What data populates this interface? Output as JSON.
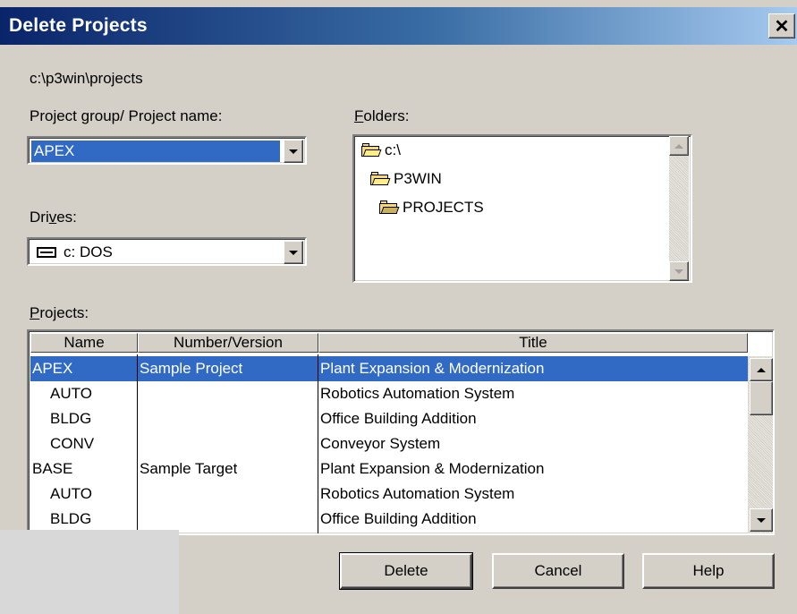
{
  "window": {
    "title": "Delete Projects"
  },
  "path": "c:\\p3win\\projects",
  "project_group": {
    "label": "Project group/ Project name:",
    "value": "APEX"
  },
  "drives": {
    "label_pre": "Dri",
    "label_u": "v",
    "label_post": "es:",
    "value": "c: DOS"
  },
  "folders": {
    "label_u": "F",
    "label_post": "olders:",
    "items": [
      "c:\\",
      "P3WIN",
      "PROJECTS"
    ]
  },
  "projects": {
    "label_u": "P",
    "label_post": "rojects:",
    "columns": [
      "Name",
      "Number/Version",
      "Title"
    ],
    "rows": [
      {
        "name": "APEX",
        "number": "Sample Project",
        "title": "Plant Expansion & Modernization",
        "selected": true
      },
      {
        "name": "AUTO",
        "number": "",
        "title": "Robotics Automation System",
        "selected": false
      },
      {
        "name": "BLDG",
        "number": "",
        "title": "Office Building Addition",
        "selected": false
      },
      {
        "name": "CONV",
        "number": "",
        "title": "Conveyor System",
        "selected": false
      },
      {
        "name": "BASE",
        "number": "Sample Target",
        "title": "Plant Expansion & Modernization",
        "selected": false
      },
      {
        "name": "AUTO",
        "number": "",
        "title": "Robotics Automation System",
        "selected": false
      },
      {
        "name": "BLDG",
        "number": "",
        "title": "Office Building Addition",
        "selected": false
      }
    ]
  },
  "buttons": {
    "delete": "Delete",
    "cancel": "Cancel",
    "help": "Help"
  },
  "colors": {
    "selection": "#316ac5",
    "face": "#d4d0c8",
    "title_start": "#0a246a"
  }
}
